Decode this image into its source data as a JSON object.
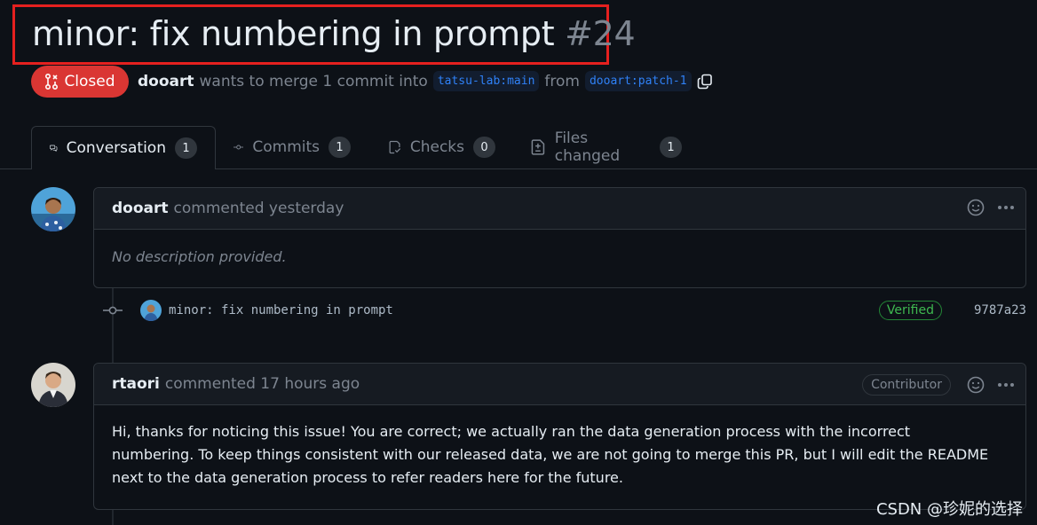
{
  "pr": {
    "title": "minor: fix numbering in prompt",
    "number": "#24",
    "state": "Closed",
    "author": "dooart",
    "meta_text": "wants to merge 1 commit into",
    "base_branch": "tatsu-lab:main",
    "from_text": "from",
    "head_branch": "dooart:patch-1"
  },
  "tabs": [
    {
      "label": "Conversation",
      "count": "1",
      "icon": "conversation-icon"
    },
    {
      "label": "Commits",
      "count": "1",
      "icon": "commit-icon"
    },
    {
      "label": "Checks",
      "count": "0",
      "icon": "checklist-icon"
    },
    {
      "label": "Files changed",
      "count": "1",
      "icon": "file-diff-icon"
    }
  ],
  "comments": [
    {
      "author": "dooart",
      "action": "commented yesterday",
      "body": "No description provided."
    },
    {
      "author": "rtaori",
      "action": "commented 17 hours ago",
      "badge": "Contributor",
      "body": "Hi, thanks for noticing this issue! You are correct; we actually ran the data generation process with the incorrect numbering. To keep things consistent with our released data, we are not going to merge this PR, but I will edit the README next to the data generation process to refer readers here for the future."
    }
  ],
  "commit": {
    "message": "minor: fix numbering in prompt",
    "verified": "Verified",
    "sha": "9787a23"
  },
  "watermark": "CSDN @珍妮的选择",
  "colors": {
    "closed": "#da3633",
    "link": "#2f81f7",
    "verified": "#3fb950",
    "highlight_box": "#e5201f"
  }
}
